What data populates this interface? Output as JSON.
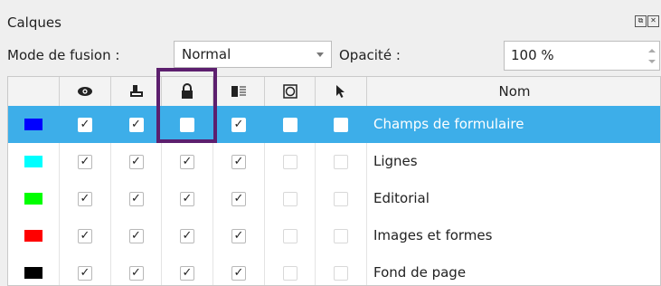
{
  "panel": {
    "title": "Calques"
  },
  "controls": {
    "blend_label": "Mode de fusion :",
    "blend_value": "Normal",
    "opacity_label": "Opacité :",
    "opacity_value": "100 %"
  },
  "table": {
    "header_icons": [
      "color-icon",
      "eye-icon",
      "print-icon",
      "lock-icon",
      "outline-icon",
      "flow-around-icon",
      "select-cursor-icon"
    ],
    "name_header": "Nom",
    "rows": [
      {
        "name": "Champs de formulaire",
        "color": "#0000ff",
        "visible": true,
        "print": true,
        "locked": false,
        "outline": true,
        "flow": false,
        "selectable": false,
        "selected": true
      },
      {
        "name": "Lignes",
        "color": "#00ffff",
        "visible": true,
        "print": true,
        "locked": true,
        "outline": true,
        "flow": false,
        "selectable": false,
        "selected": false
      },
      {
        "name": "Editorial",
        "color": "#00ff00",
        "visible": true,
        "print": true,
        "locked": true,
        "outline": true,
        "flow": false,
        "selectable": false,
        "selected": false
      },
      {
        "name": "Images et formes",
        "color": "#ff0000",
        "visible": true,
        "print": true,
        "locked": true,
        "outline": true,
        "flow": false,
        "selectable": false,
        "selected": false
      },
      {
        "name": "Fond de page",
        "color": "#000000",
        "visible": true,
        "print": true,
        "locked": true,
        "outline": true,
        "flow": false,
        "selectable": false,
        "selected": false
      }
    ]
  },
  "colors": {
    "selection": "#3daee9",
    "highlight_box": "#5c1f6e"
  }
}
